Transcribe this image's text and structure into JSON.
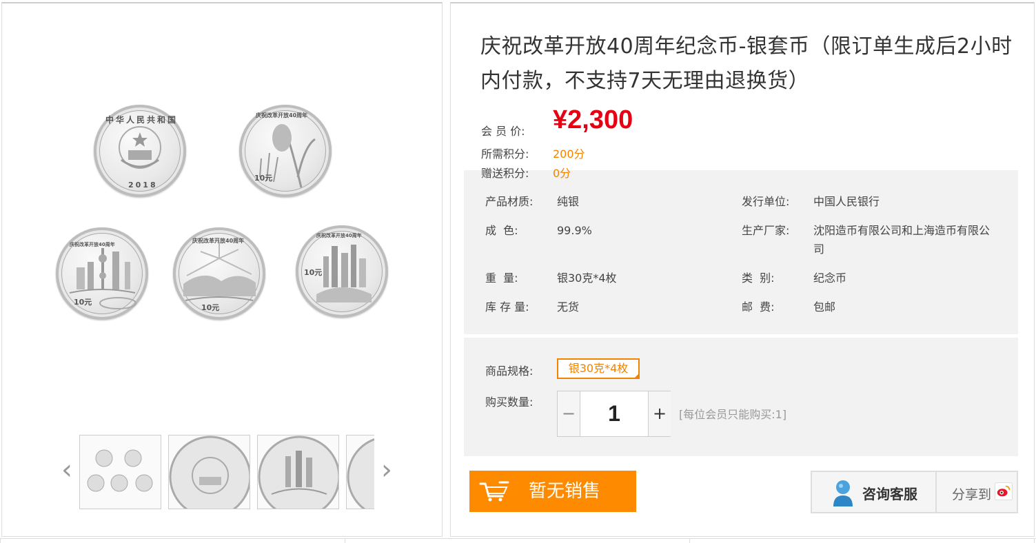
{
  "product": {
    "title": "庆祝改革开放40周年纪念币-银套币（限订单生成后2小时内付款，不支持7天无理由退换货）",
    "member_price_label": "会 员 价:",
    "price": "¥2,300",
    "points_required_label": "所需积分:",
    "points_required": "200分",
    "points_gift_label": "赠送积分:",
    "points_gift": "0分"
  },
  "attributes": {
    "material_label": "产品材质:",
    "material": "纯银",
    "issuer_label": "发行单位:",
    "issuer": "中国人民银行",
    "fineness_label": "成  色:",
    "fineness": "99.9%",
    "maker_label": "生产厂家:",
    "maker": "沈阳造币有限公司和上海造币有限公司",
    "weight_label": "重  量:",
    "weight": "银30克*4枚",
    "category_label": "类  别:",
    "category": "纪念币",
    "stock_label": "库 存 量:",
    "stock": "无货",
    "shipping_label": "邮  费:",
    "shipping": "包邮"
  },
  "purchase": {
    "spec_label": "商品规格:",
    "spec_option": "银30克*4枚",
    "qty_label": "购买数量:",
    "qty_minus": "−",
    "qty_value": "1",
    "qty_plus": "+",
    "limit_text": "[每位会员只能购买:1]",
    "buy_button": "暂无销售",
    "service_button": "咨询客服",
    "share_button": "分享到"
  },
  "coins": {
    "obverse_top_text": "中华人民共和国",
    "obverse_year": "2018",
    "reverse_top_text": "庆祝改革开放40周年",
    "denomination": "10元"
  },
  "gallery": {
    "prev_arrow": "‹",
    "next_arrow": "›"
  },
  "colors": {
    "price": "#e60012",
    "accent_orange": "#f08300",
    "buy_button": "#fe8a00"
  }
}
